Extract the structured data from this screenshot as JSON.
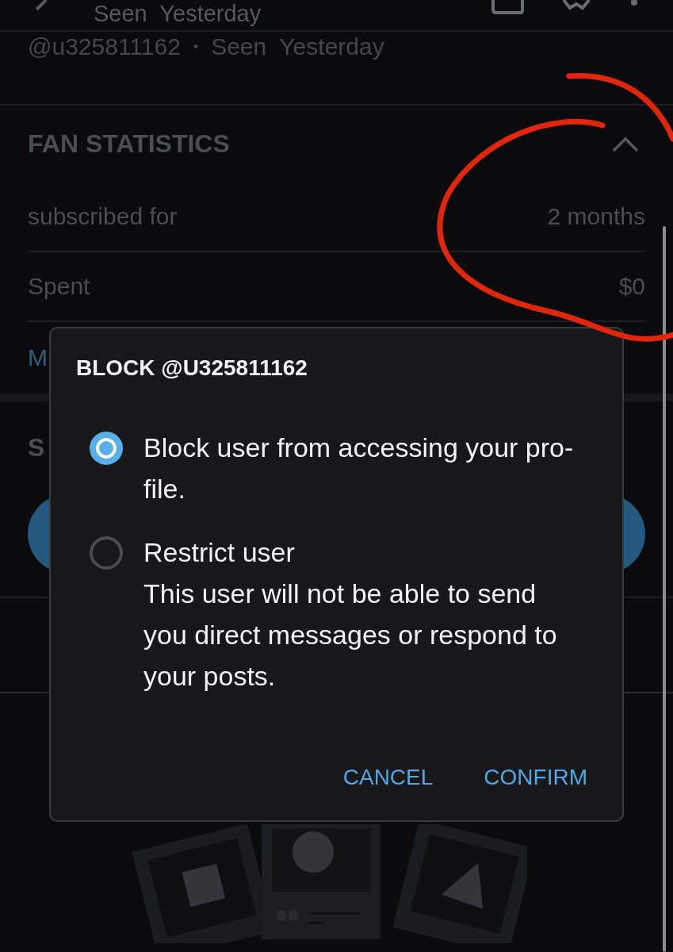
{
  "header": {
    "status": "Seen  Yesterday"
  },
  "profile": {
    "username": "@u325811162",
    "separator": "•",
    "status": "Seen  Yesterday"
  },
  "fan_statistics": {
    "title": "FAN STATISTICS",
    "expanded": true,
    "rows": [
      {
        "label": "subscribed for",
        "value": "2 months"
      },
      {
        "label": "Spent",
        "value": "$0"
      }
    ],
    "link": "M"
  },
  "section": {
    "title": "S"
  },
  "dialog": {
    "title": "BLOCK @U325811162",
    "options": [
      {
        "label": "Block user from accessing your pro-file.",
        "selected": true
      },
      {
        "label": "Restrict user",
        "description": "This user will not be able to send you direct messages or respond to your posts.",
        "selected": false
      }
    ],
    "buttons": [
      "CANCEL",
      "CONFIRM"
    ]
  }
}
